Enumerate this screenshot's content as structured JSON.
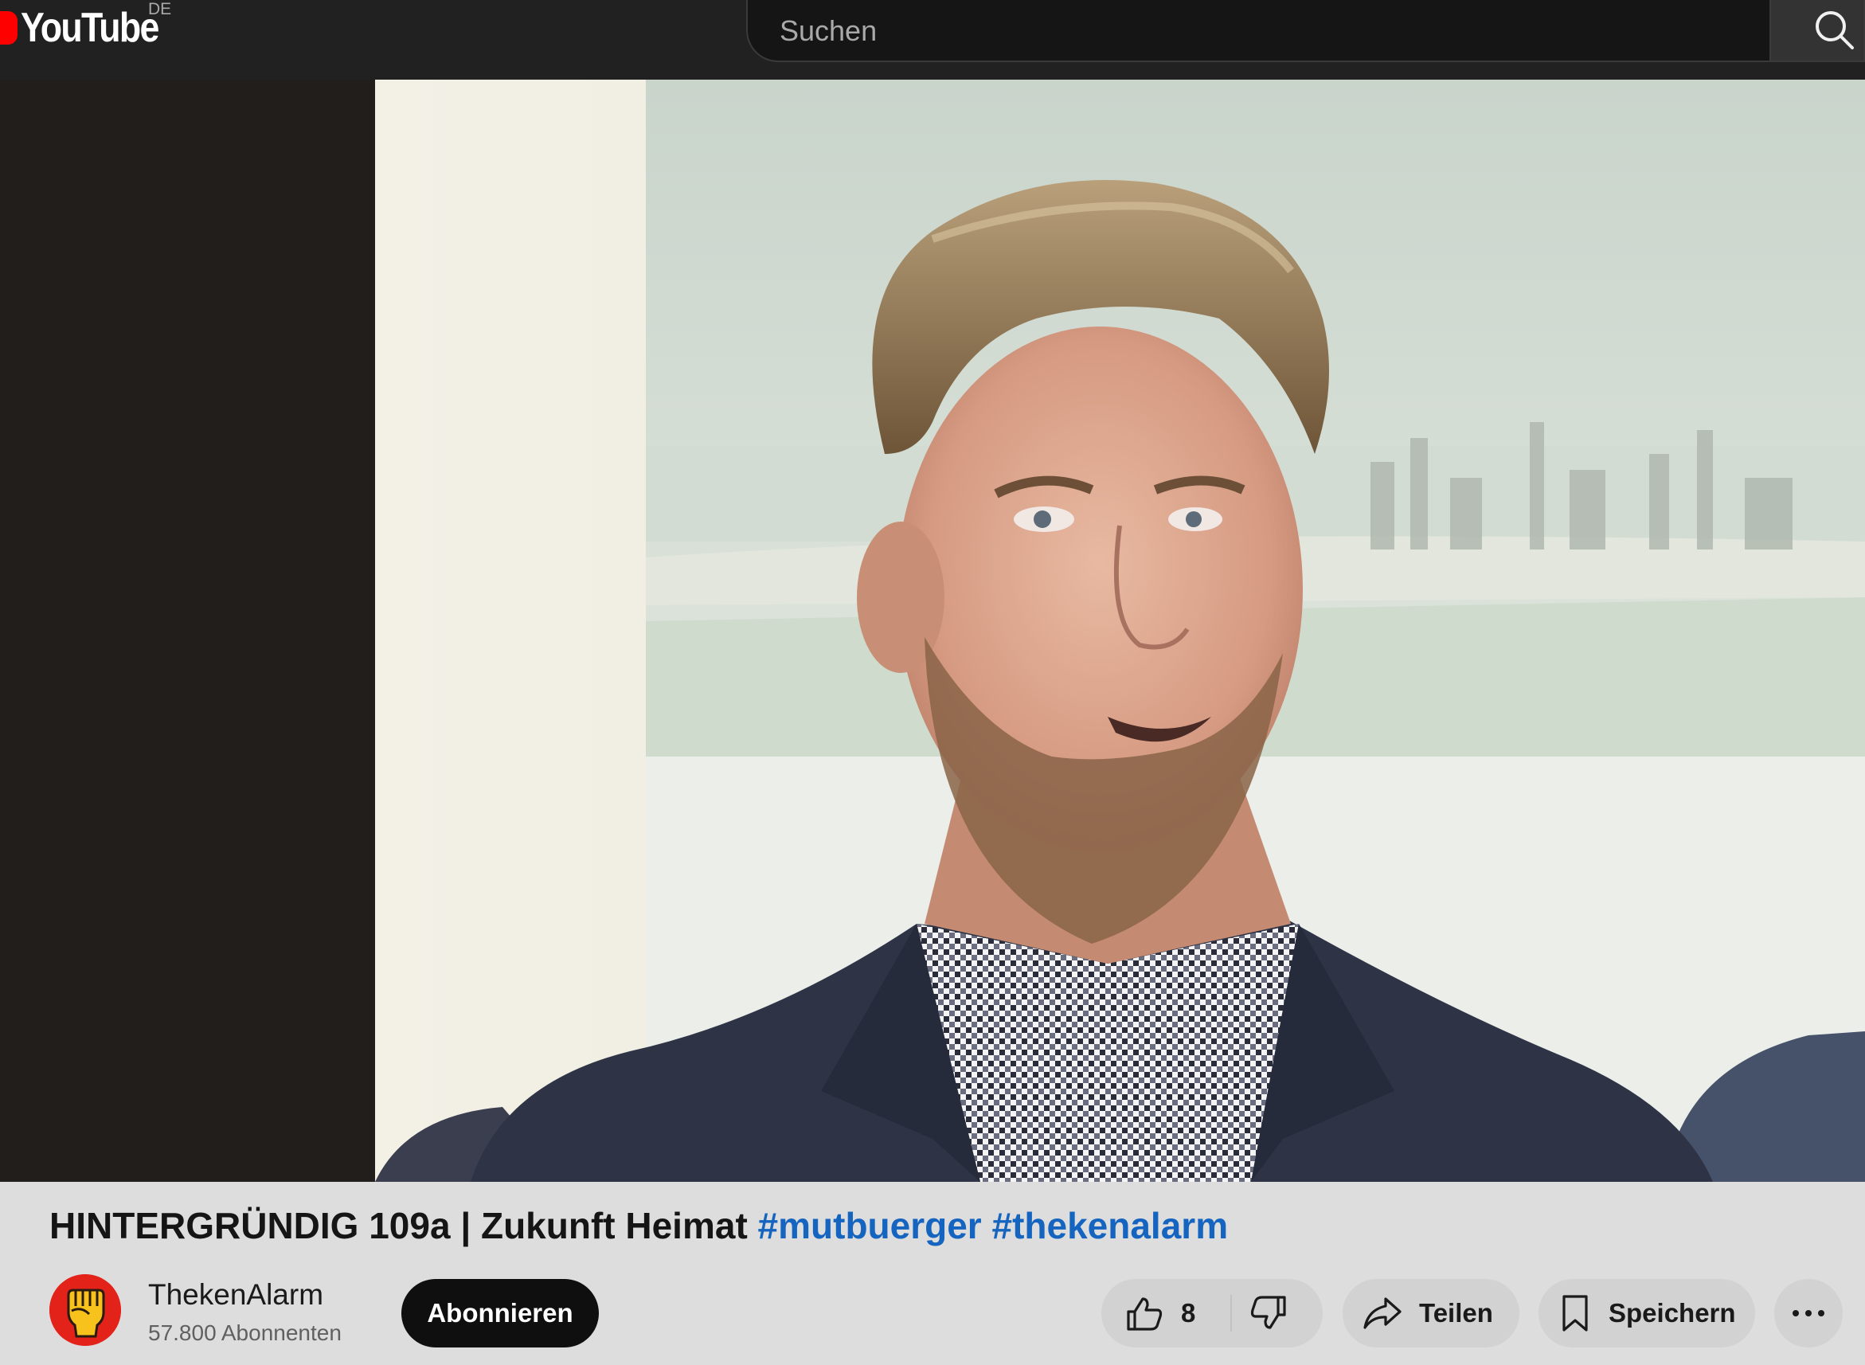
{
  "header": {
    "logo_text": "YouTube",
    "region_code": "DE",
    "search": {
      "placeholder": "Suchen",
      "button_icon": "search-icon"
    }
  },
  "video": {
    "title": "HINTERGRÜNDIG 109a | Zukunft Heimat",
    "hashtags": [
      "#mutbuerger",
      "#thekenalarm"
    ]
  },
  "channel": {
    "name": "ThekenAlarm",
    "subscribers": "57.800 Abonnenten",
    "avatar_icon": "raised-fist-icon"
  },
  "actions": {
    "subscribe_label": "Abonnieren",
    "like_count": "8",
    "like_icon": "thumbs-up-icon",
    "dislike_icon": "thumbs-down-icon",
    "share_label": "Teilen",
    "share_icon": "share-arrow-icon",
    "save_label": "Speichern",
    "save_icon": "bookmark-icon",
    "more_icon": "more-horizontal-icon"
  },
  "colors": {
    "brand_red": "#ff0000",
    "header_bg": "#222121",
    "hashtag_blue": "#1565c0",
    "subscribe_bg": "#0f0f0f",
    "avatar_bg": "#e32219"
  }
}
